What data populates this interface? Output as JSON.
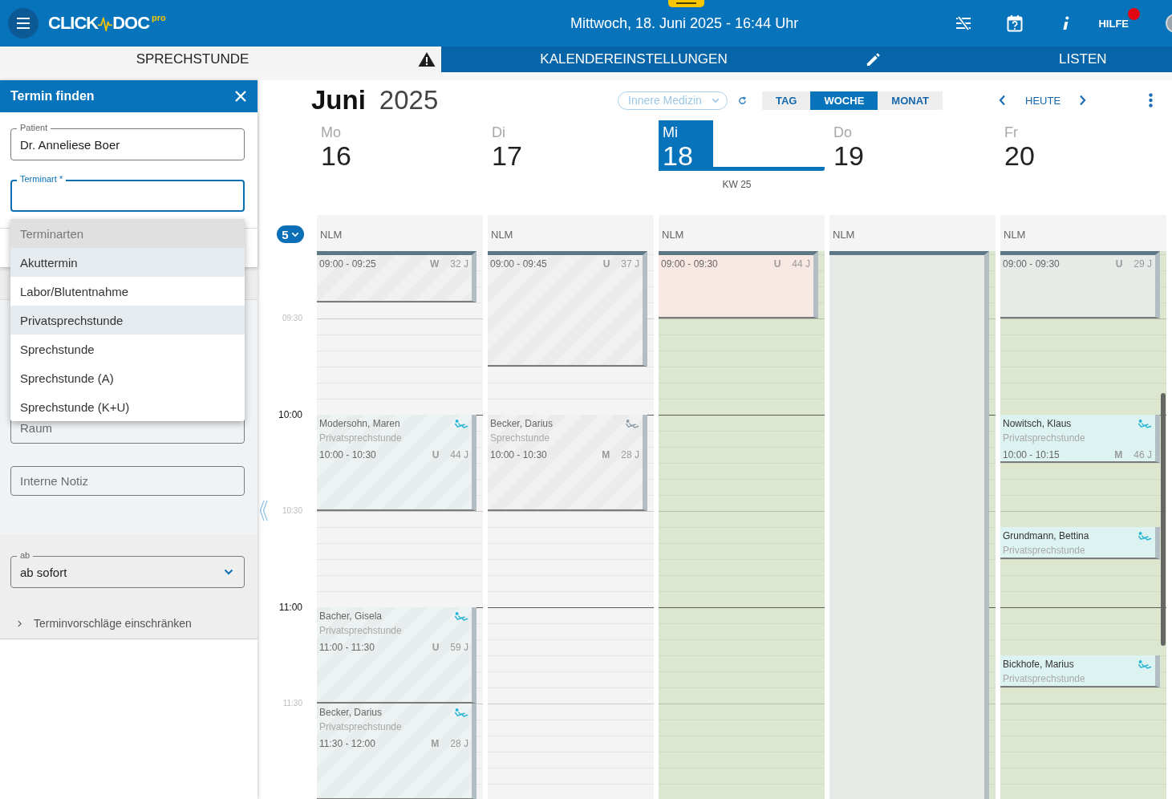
{
  "app_bar": {
    "logo": {
      "word_1": "CLICK",
      "word_2": "DOC",
      "suffix": "pro"
    },
    "datetime": "Mittwoch, 18. Juni 2025 - 16:44 Uhr",
    "help": {
      "label": "HILFE",
      "notification": true
    }
  },
  "tabs": [
    {
      "label": "SPRECHSTUNDE",
      "selected": true
    },
    {
      "label": "KALENDEREINSTELLUNGEN",
      "selected": false
    },
    {
      "label": "LISTEN",
      "selected": false
    }
  ],
  "find_panel": {
    "title": "Termin finden",
    "patient": {
      "label": "Patient",
      "value": "Dr. Anneliese Boer"
    },
    "appointment_type": {
      "label": "Terminart *",
      "focused": true,
      "menu": {
        "heading": "Terminarten",
        "options": [
          {
            "label": "Akuttermin",
            "selected": true
          },
          {
            "label": "Labor/Blutentnahme",
            "selected": false
          },
          {
            "label": "Privatsprechstunde",
            "selected": true
          },
          {
            "label": "Sprechstunde",
            "selected": false
          },
          {
            "label": "Sprechstunde (A)",
            "selected": false
          },
          {
            "label": "Sprechstunde (K+U)",
            "selected": false
          }
        ]
      }
    },
    "room": {
      "placeholder": "Raum"
    },
    "note": {
      "placeholder": "Interne Notiz"
    },
    "start": {
      "label": "ab",
      "value": "ab sofort"
    },
    "restrict": {
      "label": "Terminvorschläge einschränken",
      "expanded": false
    }
  },
  "calendar": {
    "month": "Juni",
    "year": "2025",
    "department": {
      "value": "Innere Medizin",
      "disabled": true
    },
    "views": [
      {
        "label": "TAG",
        "selected": false
      },
      {
        "label": "WOCHE",
        "selected": true
      },
      {
        "label": "MONAT",
        "selected": false
      }
    ],
    "today_label": "HEUTE",
    "week_label": "KW 25",
    "resource_count": "5",
    "time_labels": [
      {
        "label": "09:30",
        "major": false
      },
      {
        "label": "10:00",
        "major": true
      },
      {
        "label": "10:30",
        "major": false
      },
      {
        "label": "11:00",
        "major": true
      },
      {
        "label": "11:30",
        "major": false
      }
    ],
    "days": [
      {
        "weekday": "Mo",
        "date": "16",
        "selected": false,
        "past": true,
        "open": false,
        "resource": "NLM",
        "events": [
          {
            "time": "09:00 - 09:25",
            "code": "W",
            "age": "32 J",
            "color": "#f1f1f1"
          },
          {
            "name": "Modersohn, Maren",
            "type": "Privatsprechstunde",
            "time": "10:00 - 10:30",
            "code": "U",
            "age": "44 J",
            "color": "#edf2f3",
            "icon_active": true
          },
          {
            "name": "Bacher, Gisela",
            "type": "Privatsprechstunde",
            "time": "11:00 - 11:30",
            "code": "U",
            "age": "59 J",
            "color": "#edf2f3",
            "icon_active": true
          },
          {
            "name": "Becker, Darius",
            "type": "Privatsprechstunde",
            "time": "11:30 - 12:00",
            "code": "M",
            "age": "28 J",
            "color": "#edf2f3",
            "icon_active": true
          }
        ]
      },
      {
        "weekday": "Di",
        "date": "17",
        "selected": false,
        "past": true,
        "open": false,
        "resource": "NLM",
        "events": [
          {
            "time": "09:00 - 09:45",
            "code": "U",
            "age": "37 J",
            "color": "#f1f1f1"
          },
          {
            "name": "Becker, Darius",
            "type": "Sprechstunde",
            "time": "10:00 - 10:30",
            "code": "M",
            "age": "28 J",
            "color": "#f1f1f1",
            "icon_active": false
          }
        ]
      },
      {
        "weekday": "Mi",
        "date": "18",
        "selected": true,
        "past": false,
        "open": true,
        "resource": "NLM",
        "events": [
          {
            "time": "09:00 - 09:30",
            "code": "U",
            "age": "44 J",
            "color": "#f8e8e4"
          }
        ]
      },
      {
        "weekday": "Do",
        "date": "19",
        "selected": false,
        "past": false,
        "open": true,
        "resource": "NLM",
        "events": [
          {
            "color": "#e6ebe7"
          }
        ]
      },
      {
        "weekday": "Fr",
        "date": "20",
        "selected": false,
        "past": false,
        "open": true,
        "resource": "NLM",
        "events": [
          {
            "time": "09:00 - 09:30",
            "code": "U",
            "age": "29 J",
            "color": "#e6ebe7"
          },
          {
            "name": "Nowitsch, Klaus",
            "type": "Privatsprechstunde",
            "time": "10:00 - 10:15",
            "code": "M",
            "age": "46 J",
            "color": "#dcf3f1",
            "icon_active": true
          },
          {
            "name": "Grundmann, Bettina",
            "type": "Privatsprechstunde",
            "color": "#dcf3f1",
            "icon_active": true
          },
          {
            "name": "Bickhofe, Marius",
            "type": "Privatsprechstunde",
            "color": "#dcf3f1",
            "icon_active": true
          }
        ]
      }
    ]
  }
}
